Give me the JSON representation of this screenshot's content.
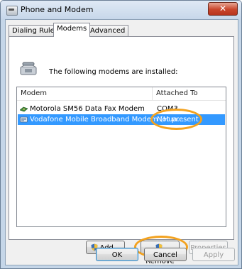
{
  "window": {
    "title": "Phone and Modem",
    "close_glyph": "✕"
  },
  "tabs": [
    {
      "label": "Dialing Rules",
      "active": false
    },
    {
      "label": "Modems",
      "active": true
    },
    {
      "label": "Advanced",
      "active": false
    }
  ],
  "intro_text": "The following modems are installed:",
  "list": {
    "columns": [
      "Modem",
      "Attached To"
    ],
    "rows": [
      {
        "name": "Motorola SM56 Data Fax Modem",
        "attached": "COM3",
        "selected": false,
        "icon": "modem-board-icon"
      },
      {
        "name": "Vodafone Mobile Broadband Modem (Hua...",
        "attached": "Not present",
        "selected": true,
        "icon": "broadband-modem-icon"
      }
    ]
  },
  "panel_buttons": {
    "add": "Add...",
    "remove": "Remove",
    "properties": "Properties"
  },
  "dialog_buttons": {
    "ok": "OK",
    "cancel": "Cancel",
    "apply": "Apply"
  },
  "colors": {
    "selection": "#3399ff",
    "highlight_ring": "#f3a21f",
    "title_bar": "#c7d7ea"
  }
}
